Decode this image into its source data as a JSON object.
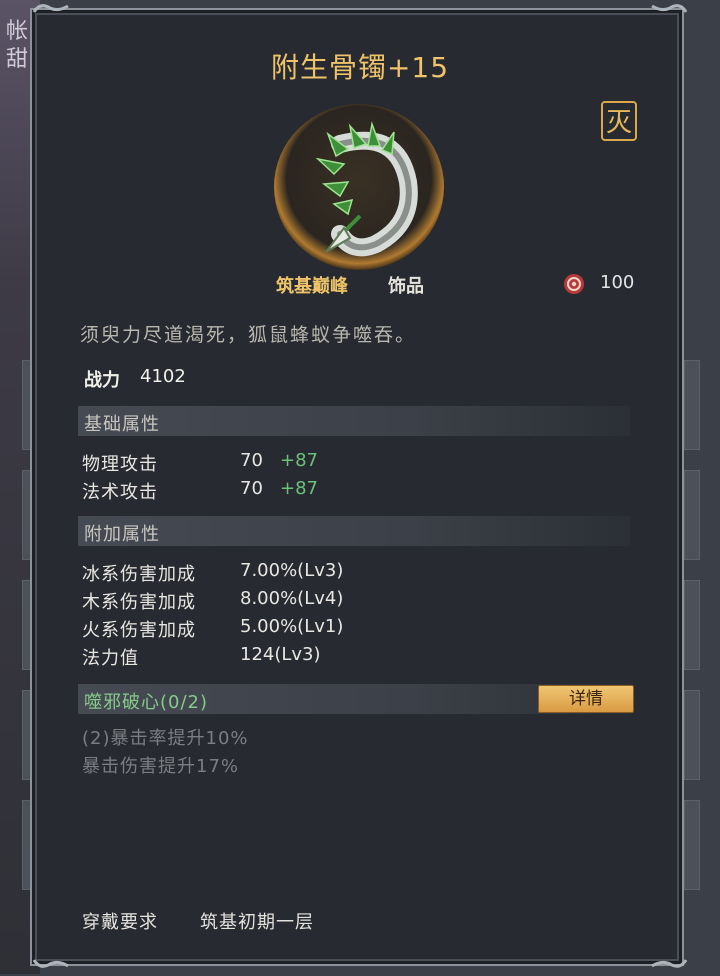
{
  "background": {
    "fragment_text": "帐 甜"
  },
  "item": {
    "name": "附生骨镯+15",
    "seal_glyph": "灭",
    "rank": "筑基巅峰",
    "category": "饰品",
    "price_icon": "red-spiral-icon",
    "price": "100",
    "flavor_text": "须臾力尽道渴死，狐鼠蜂蚁争噬吞。",
    "power_label": "战力",
    "power_value": "4102"
  },
  "base_attributes": {
    "header": "基础属性",
    "rows": [
      {
        "name": "物理攻击",
        "value": "70",
        "bonus": "+87"
      },
      {
        "name": "法术攻击",
        "value": "70",
        "bonus": "+87"
      }
    ]
  },
  "extra_attributes": {
    "header": "附加属性",
    "rows": [
      {
        "name": "冰系伤害加成",
        "value": "7.00%(Lv3)"
      },
      {
        "name": "木系伤害加成",
        "value": "8.00%(Lv4)"
      },
      {
        "name": "火系伤害加成",
        "value": "5.00%(Lv1)"
      },
      {
        "name": "法力值",
        "value": "124(Lv3)"
      }
    ]
  },
  "set_bonus": {
    "name": "噬邪破心(0/2)",
    "detail_button": "详情",
    "effects": [
      "(2)暴击率提升10%",
      "暴击伤害提升17%"
    ]
  },
  "requirement": {
    "label": "穿戴要求",
    "value": "筑基初期一层"
  },
  "colors": {
    "gold": "#efc36a",
    "green": "#6cc07a",
    "panel": "#272b31"
  }
}
